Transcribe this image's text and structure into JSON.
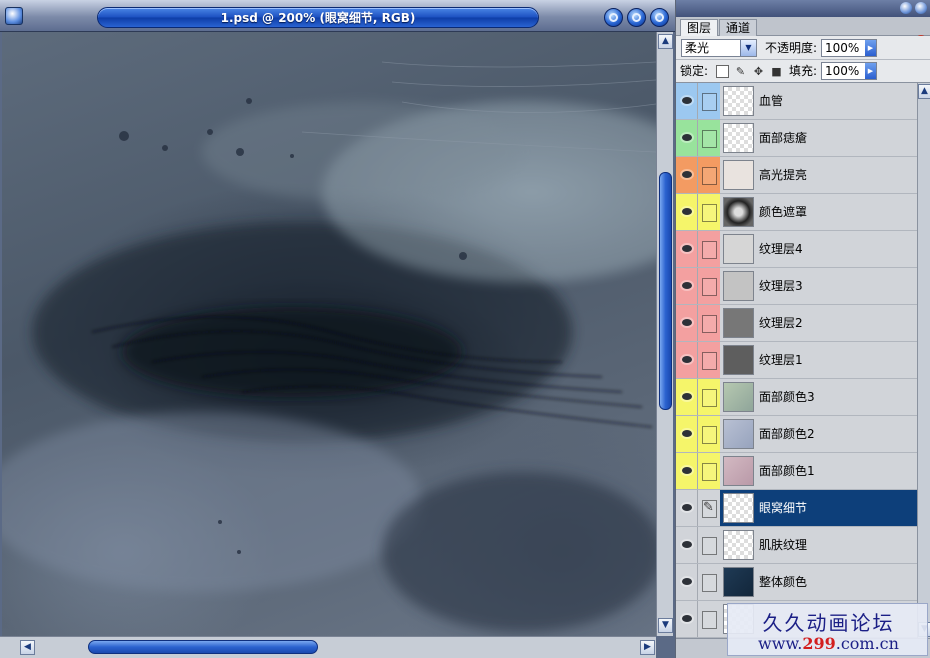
{
  "document": {
    "title": "1.psd @ 200% (眼窝细节, RGB)"
  },
  "palette": {
    "tabs": [
      {
        "label": "图层",
        "active": true
      },
      {
        "label": "通道",
        "active": false
      }
    ],
    "blend_mode": "柔光",
    "opacity_label": "不透明度:",
    "opacity_value": "100%",
    "lock_label": "锁定:",
    "fill_label": "填充:",
    "fill_value": "100%",
    "layers": [
      {
        "name": "血管",
        "color": "#9cc8f0",
        "active": false,
        "thumb": "transparent"
      },
      {
        "name": "面部痣瘡",
        "color": "#98e39c",
        "active": false,
        "thumb": "transparent"
      },
      {
        "name": "高光提亮",
        "color": "#f39b62",
        "active": false,
        "thumb": "light"
      },
      {
        "name": "颜色遮罩",
        "color": "#f5f56a",
        "active": false,
        "thumb": "mask"
      },
      {
        "name": "纹理层4",
        "color": "#f3a0a0",
        "active": false,
        "thumb": "texture-light"
      },
      {
        "name": "纹理层3",
        "color": "#f3a0a0",
        "active": false,
        "thumb": "texture-mid"
      },
      {
        "name": "纹理层2",
        "color": "#f3a0a0",
        "active": false,
        "thumb": "texture-dark"
      },
      {
        "name": "纹理层1",
        "color": "#f3a0a0",
        "active": false,
        "thumb": "texture-darker"
      },
      {
        "name": "面部颜色3",
        "color": "#f5f56a",
        "active": false,
        "thumb": "face-green"
      },
      {
        "name": "面部颜色2",
        "color": "#f5f56a",
        "active": false,
        "thumb": "face-blue"
      },
      {
        "name": "面部颜色1",
        "color": "#f5f56a",
        "active": false,
        "thumb": "face-pink"
      },
      {
        "name": "眼窝细节",
        "color": "#d1d4d9",
        "active": true,
        "thumb": "transparent"
      },
      {
        "name": "肌肤纹理",
        "color": "#d1d4d9",
        "active": false,
        "thumb": "transparent"
      },
      {
        "name": "整体颜色",
        "color": "#d1d4d9",
        "active": false,
        "thumb": "dark-blue"
      },
      {
        "name": "",
        "color": "#d1d4d9",
        "active": false,
        "thumb": "transparent"
      }
    ]
  },
  "watermark": {
    "line1": "久久动画论坛",
    "line2_prefix": "www.",
    "line2_num": "299",
    "line2_suffix": ".com.cn"
  }
}
